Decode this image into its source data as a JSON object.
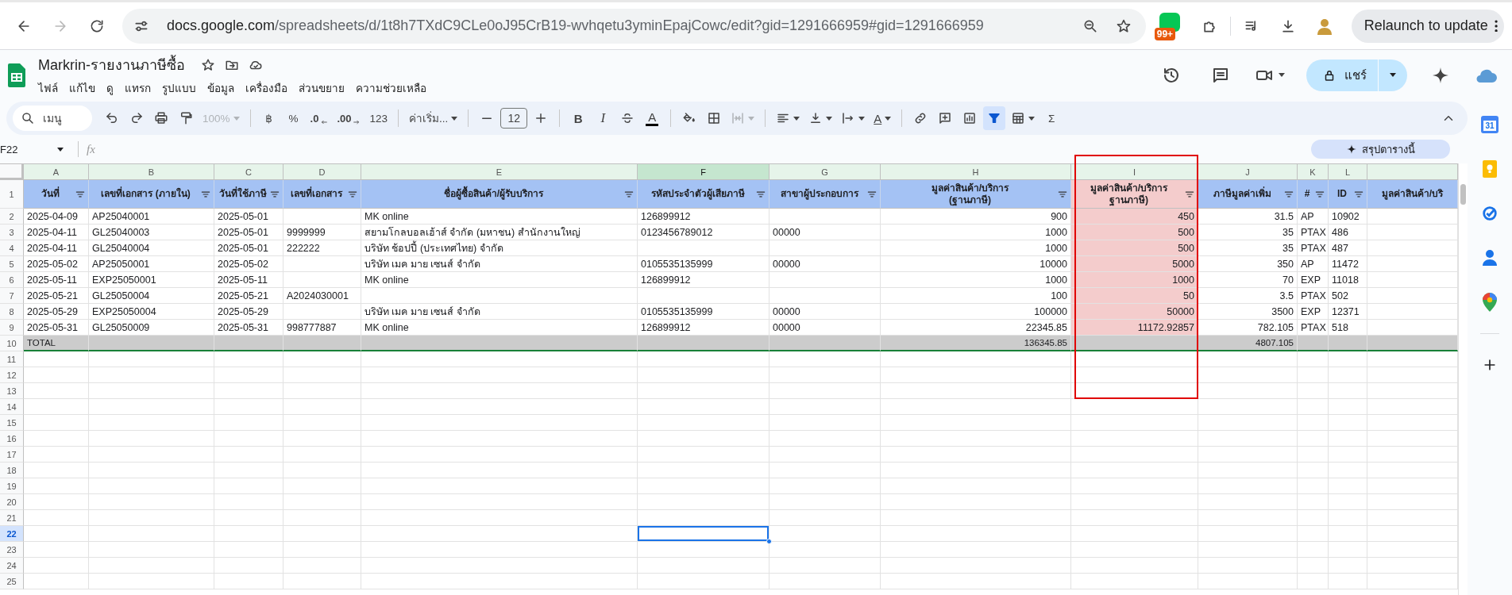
{
  "browser": {
    "url_host": "docs.google.com",
    "url_path": "/spreadsheets/d/1t8h7TXdC9CLe0oJ95CrB19-wvhqetu3yminEpajCowc/edit?gid=1291666959#gid=1291666959",
    "extension_badge": "99+",
    "relaunch": "Relaunch to update"
  },
  "document": {
    "title": "Markrin-รายงานภาษีซื้อ",
    "menus": [
      "ไฟล์",
      "แก้ไข",
      "ดู",
      "แทรก",
      "รูปแบบ",
      "ข้อมูล",
      "เครื่องมือ",
      "ส่วนขยาย",
      "ความช่วยเหลือ"
    ],
    "share": "แชร์"
  },
  "toolbar": [
    {
      "kind": "search",
      "placeholder": "เมนู"
    },
    {
      "kind": "undo"
    },
    {
      "kind": "redo"
    },
    {
      "kind": "print"
    },
    {
      "kind": "paint-format"
    },
    {
      "kind": "text",
      "text": "100%",
      "caret": true,
      "disabled": true
    },
    {
      "kind": "sep"
    },
    {
      "kind": "text",
      "text": "฿"
    },
    {
      "kind": "text",
      "text": "%"
    },
    {
      "kind": "decrease-decimal",
      "text": ".0"
    },
    {
      "kind": "increase-decimal",
      "text": ".00"
    },
    {
      "kind": "text",
      "text": "123"
    },
    {
      "kind": "sep"
    },
    {
      "kind": "text",
      "text": "ค่าเริ่ม...",
      "caret": true
    },
    {
      "kind": "sep"
    },
    {
      "kind": "minus"
    },
    {
      "kind": "size",
      "text": "12"
    },
    {
      "kind": "plus"
    },
    {
      "kind": "sep"
    },
    {
      "kind": "bold",
      "text": "B"
    },
    {
      "kind": "italic",
      "text": "I"
    },
    {
      "kind": "strikethrough"
    },
    {
      "kind": "text-color",
      "text": "A"
    },
    {
      "kind": "sep"
    },
    {
      "kind": "fill-color"
    },
    {
      "kind": "borders"
    },
    {
      "kind": "merge",
      "caret": true,
      "disabled": true
    },
    {
      "kind": "sep"
    },
    {
      "kind": "align",
      "caret": true
    },
    {
      "kind": "valign",
      "caret": true
    },
    {
      "kind": "wrap",
      "caret": true
    },
    {
      "kind": "rotate",
      "text": "A",
      "caret": true
    },
    {
      "kind": "sep"
    },
    {
      "kind": "link"
    },
    {
      "kind": "comment-add"
    },
    {
      "kind": "chart"
    },
    {
      "kind": "filter",
      "on": true
    },
    {
      "kind": "filter-views",
      "caret": true
    },
    {
      "kind": "text",
      "text": "Σ"
    }
  ],
  "formula_bar": {
    "name_box": "F22",
    "fx": "fx",
    "summary_button": "สรุปตารางนี้"
  },
  "columns": [
    {
      "letter": "A",
      "header": "วันที่",
      "kind": "text",
      "selected": false,
      "highlighted": false
    },
    {
      "letter": "B",
      "header": "เลขที่เอกสาร (ภายใน)",
      "kind": "text",
      "selected": false,
      "highlighted": false
    },
    {
      "letter": "C",
      "header": "วันที่ใช้ภาษี",
      "kind": "text",
      "selected": false,
      "highlighted": false
    },
    {
      "letter": "D",
      "header": "เลขที่เอกสาร",
      "kind": "text",
      "selected": false,
      "highlighted": false
    },
    {
      "letter": "E",
      "header": "ชื่อผู้ซื้อสินค้า/ผู้รับบริการ",
      "kind": "text",
      "selected": false,
      "highlighted": false
    },
    {
      "letter": "F",
      "header": "รหัสประจำตัวผู้เสียภาษี",
      "kind": "text",
      "selected": true,
      "highlighted": false
    },
    {
      "letter": "G",
      "header": "สาขาผู้ประกอบการ",
      "kind": "text",
      "selected": false,
      "highlighted": false
    },
    {
      "letter": "H",
      "header": "มูลค่าสินค้า/บริการ\n(ฐานภาษี)",
      "kind": "number",
      "selected": false,
      "highlighted": false
    },
    {
      "letter": "I",
      "header": "มูลค่าสินค้า/บริการ\nฐานภาษี)",
      "kind": "number",
      "selected": false,
      "highlighted": true
    },
    {
      "letter": "J",
      "header": "ภาษีมูลค่าเพิ่ม",
      "kind": "number",
      "selected": false,
      "highlighted": false
    },
    {
      "letter": "K",
      "header": "#",
      "kind": "text",
      "selected": false,
      "highlighted": false
    },
    {
      "letter": "L",
      "header": "ID",
      "kind": "text",
      "selected": false,
      "highlighted": false
    },
    {
      "header": "มูลค่าสินค้า/บริ",
      "kind": "number",
      "selected": false,
      "highlighted": false
    }
  ],
  "header_row": {
    "number": "1"
  },
  "rows": [
    {
      "number": "2",
      "kind": "data",
      "selected": false,
      "cells": [
        "2025-04-09",
        "AP25040001",
        "2025-05-01",
        null,
        "MK online",
        "126899912",
        null,
        "900",
        "450",
        "31.5",
        "AP",
        "10902",
        null
      ]
    },
    {
      "number": "3",
      "kind": "data",
      "selected": false,
      "cells": [
        "2025-04-11",
        "GL25040003",
        "2025-05-01",
        "9999999",
        "สยามโกลบอลเฮ้าส์ จำกัด (มหาชน) สำนักงานใหญ่",
        "0123456789012",
        "00000",
        "1000",
        "500",
        "35",
        "PTAX",
        "486",
        null
      ]
    },
    {
      "number": "4",
      "kind": "data",
      "selected": false,
      "cells": [
        "2025-04-11",
        "GL25040004",
        "2025-05-01",
        "222222",
        "บริษัท ช้อปปี้ (ประเทศไทย) จำกัด",
        null,
        null,
        "1000",
        "500",
        "35",
        "PTAX",
        "487",
        null
      ]
    },
    {
      "number": "5",
      "kind": "data",
      "selected": false,
      "cells": [
        "2025-05-02",
        "AP25050001",
        "2025-05-02",
        null,
        "บริษัท เมค มาย เซนส์ จำกัด",
        "0105535135999",
        "00000",
        "10000",
        "5000",
        "350",
        "AP",
        "11472",
        null
      ]
    },
    {
      "number": "6",
      "kind": "data",
      "selected": false,
      "cells": [
        "2025-05-11",
        "EXP25050001",
        "2025-05-11",
        null,
        "MK online",
        "126899912",
        null,
        "1000",
        "1000",
        "70",
        "EXP",
        "11018",
        null
      ]
    },
    {
      "number": "7",
      "kind": "data",
      "selected": false,
      "cells": [
        "2025-05-21",
        "GL25050004",
        "2025-05-21",
        "A2024030001",
        null,
        null,
        null,
        "100",
        "50",
        "3.5",
        "PTAX",
        "502",
        null
      ]
    },
    {
      "number": "8",
      "kind": "data",
      "selected": false,
      "cells": [
        "2025-05-29",
        "EXP25050004",
        "2025-05-29",
        null,
        "บริษัท เมค มาย เซนส์ จำกัด",
        "0105535135999",
        "00000",
        "100000",
        "50000",
        "3500",
        "EXP",
        "12371",
        null
      ]
    },
    {
      "number": "9",
      "kind": "data",
      "selected": false,
      "cells": [
        "2025-05-31",
        "GL25050009",
        "2025-05-31",
        "998777887",
        "MK online",
        "126899912",
        "00000",
        "22345.85",
        "11172.92857",
        "782.105",
        "PTAX",
        "518",
        null
      ]
    },
    {
      "number": "10",
      "kind": "total",
      "selected": false,
      "cells": [
        "TOTAL",
        null,
        null,
        null,
        null,
        null,
        null,
        "136345.85",
        null,
        "4807.105",
        null,
        null,
        null
      ]
    },
    {
      "number": "11",
      "selected": false
    },
    {
      "number": "12",
      "selected": false
    },
    {
      "number": "13",
      "selected": false
    },
    {
      "number": "14",
      "selected": false
    },
    {
      "number": "15",
      "selected": false
    },
    {
      "number": "16",
      "selected": false
    },
    {
      "number": "17",
      "selected": false
    },
    {
      "number": "18",
      "selected": false
    },
    {
      "number": "19",
      "selected": false
    },
    {
      "number": "20",
      "selected": false
    },
    {
      "number": "21",
      "selected": false
    },
    {
      "number": "22",
      "selected": true
    },
    {
      "number": "23",
      "selected": false
    },
    {
      "number": "24",
      "selected": false
    },
    {
      "number": "25",
      "selected": false
    }
  ],
  "side_panel": {
    "calendar_day": "31"
  }
}
